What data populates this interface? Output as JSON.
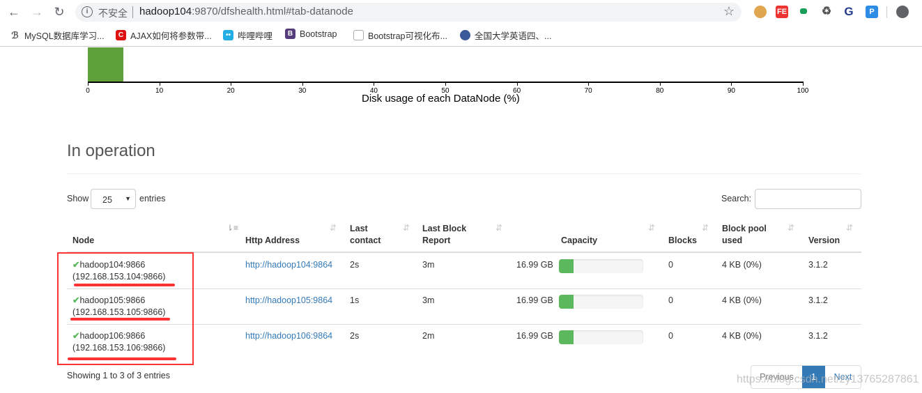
{
  "browser": {
    "insecure_label": "不安全",
    "url_host": "hadoop104",
    "url_rest": ":9870/dfshealth.html#tab-datanode",
    "bookmarks": [
      {
        "label": "MySQL数据库学习...",
        "icon": "mysql-icon"
      },
      {
        "label": "AJAX如何将参数带...",
        "icon": "csdn-icon"
      },
      {
        "label": "哔哩哔哩",
        "icon": "bilibili-icon"
      },
      {
        "label": "Bootstrap",
        "icon": "bootstrap-icon"
      },
      {
        "label": "Bootstrap可视化布...",
        "icon": "layout-icon"
      },
      {
        "label": "全国大学英语四、...",
        "icon": "cet-icon"
      }
    ],
    "extensions": [
      {
        "icon": "cookie-icon"
      },
      {
        "label": "FE",
        "icon": "fe-icon"
      },
      {
        "icon": "green-ext-icon"
      },
      {
        "icon": "recycle-icon"
      },
      {
        "label": "G",
        "icon": "g-icon"
      },
      {
        "label": "P",
        "icon": "p-icon"
      }
    ]
  },
  "chart_data": {
    "type": "bar",
    "title": "Disk usage of each DataNode (%)",
    "xlim": [
      0,
      100
    ],
    "xticks": [
      "0",
      "10",
      "20",
      "30",
      "40",
      "50",
      "60",
      "70",
      "80",
      "90",
      "100"
    ],
    "bins": [
      {
        "x0": 0,
        "x1": 5
      }
    ],
    "color": "#5fa23b"
  },
  "section": {
    "title": "In operation",
    "show_label": "Show",
    "entries_value": "25",
    "entries_label": "entries",
    "search_label": "Search:",
    "search_value": ""
  },
  "table": {
    "headers": {
      "node": "Node",
      "http": "Http Address",
      "last_contact_1": "Last",
      "last_contact_2": "contact",
      "last_block_1": "Last Block",
      "last_block_2": "Report",
      "capacity": "Capacity",
      "blocks": "Blocks",
      "pool_1": "Block pool",
      "pool_2": "used",
      "version": "Version"
    },
    "rows": [
      {
        "node": "hadoop104:9866",
        "ip": "(192.168.153.104:9866)",
        "http": "http://hadoop104:9864",
        "last_contact": "2s",
        "last_block": "3m",
        "capacity": "16.99 GB",
        "usage_pct": 17,
        "blocks": "0",
        "pool_used": "4 KB (0%)",
        "version": "3.1.2"
      },
      {
        "node": "hadoop105:9866",
        "ip": "(192.168.153.105:9866)",
        "http": "http://hadoop105:9864",
        "last_contact": "1s",
        "last_block": "3m",
        "capacity": "16.99 GB",
        "usage_pct": 17,
        "blocks": "0",
        "pool_used": "4 KB (0%)",
        "version": "3.1.2"
      },
      {
        "node": "hadoop106:9866",
        "ip": "(192.168.153.106:9866)",
        "http": "http://hadoop106:9864",
        "last_contact": "2s",
        "last_block": "2m",
        "capacity": "16.99 GB",
        "usage_pct": 17,
        "blocks": "0",
        "pool_used": "4 KB (0%)",
        "version": "3.1.2"
      }
    ],
    "info": "Showing 1 to 3 of 3 entries"
  },
  "pager": {
    "previous": "Previous",
    "current": "1",
    "next": "Next",
    "accent": "#337ab7"
  },
  "watermark": "https://blog.csdn.net/zy13765287861"
}
